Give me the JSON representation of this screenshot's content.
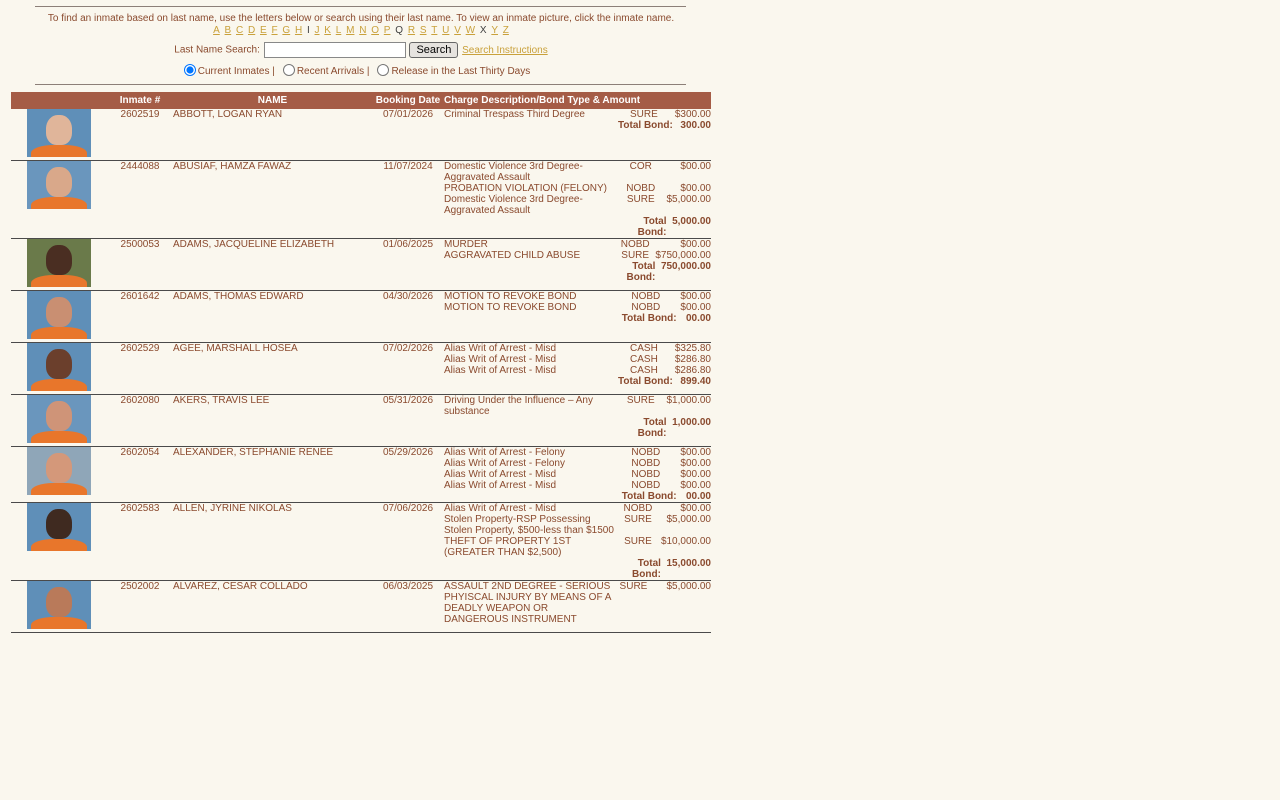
{
  "instructions": "To find an inmate based on last name, use the letters below or search using their last name.  To view an inmate picture, click the inmate name.",
  "letters": [
    {
      "l": "A",
      "on": true
    },
    {
      "l": "B",
      "on": true
    },
    {
      "l": "C",
      "on": true
    },
    {
      "l": "D",
      "on": true
    },
    {
      "l": "E",
      "on": true
    },
    {
      "l": "F",
      "on": true
    },
    {
      "l": "G",
      "on": true
    },
    {
      "l": "H",
      "on": true
    },
    {
      "l": "I",
      "on": false
    },
    {
      "l": "J",
      "on": true
    },
    {
      "l": "K",
      "on": true
    },
    {
      "l": "L",
      "on": true
    },
    {
      "l": "M",
      "on": true
    },
    {
      "l": "N",
      "on": true
    },
    {
      "l": "O",
      "on": true
    },
    {
      "l": "P",
      "on": true
    },
    {
      "l": "Q",
      "on": false
    },
    {
      "l": "R",
      "on": true
    },
    {
      "l": "S",
      "on": true
    },
    {
      "l": "T",
      "on": true
    },
    {
      "l": "U",
      "on": true
    },
    {
      "l": "V",
      "on": true
    },
    {
      "l": "W",
      "on": true
    },
    {
      "l": "X",
      "on": false
    },
    {
      "l": "Y",
      "on": true
    },
    {
      "l": "Z",
      "on": true
    }
  ],
  "search": {
    "label": "Last Name Search:",
    "value": "",
    "button": "Search",
    "help_link": "Search Instructions"
  },
  "filters": [
    {
      "label": "Current Inmates |",
      "checked": true
    },
    {
      "label": "Recent Arrivals |",
      "checked": false
    },
    {
      "label": "Release in the Last Thirty Days",
      "checked": false
    }
  ],
  "columns": {
    "photo": "",
    "number": "Inmate #",
    "name": "NAME",
    "date": "Booking Date",
    "charges": "Charge Description/Bond Type & Amount"
  },
  "total_label": "Total Bond:",
  "colors": {
    "header": "#a55c46",
    "text": "#8a4a2e",
    "link": "#c9a13b",
    "background": "#faf7ee"
  },
  "inmates": [
    {
      "number": "2602519",
      "name": "ABBOTT, LOGAN RYAN",
      "date": "07/01/2026",
      "total": "300.00",
      "mug": {
        "skin": "#e0b59a",
        "bg": "#5f8fb8"
      },
      "charges": [
        {
          "desc": "Criminal Trespass Third Degree",
          "type": "SURE",
          "amount": "$300.00"
        }
      ]
    },
    {
      "number": "2444088",
      "name": "ABUSIAF, HAMZA FAWAZ",
      "date": "11/07/2024",
      "total": "5,000.00",
      "mug": {
        "skin": "#d9a88a",
        "bg": "#6a96bd"
      },
      "charges": [
        {
          "desc": "Domestic Violence 3rd Degree- Aggravated Assault",
          "type": "COR",
          "amount": "$00.00"
        },
        {
          "desc": "PROBATION VIOLATION (FELONY)",
          "type": "NOBD",
          "amount": "$00.00"
        },
        {
          "desc": "Domestic Violence 3rd Degree- Aggravated Assault",
          "type": "SURE",
          "amount": "$5,000.00"
        }
      ]
    },
    {
      "number": "2500053",
      "name": "ADAMS, JACQUELINE ELIZABETH",
      "date": "01/06/2025",
      "total": "750,000.00",
      "mug": {
        "skin": "#4a2e22",
        "bg": "#6a7a4a"
      },
      "charges": [
        {
          "desc": "MURDER",
          "type": "NOBD",
          "amount": "$00.00"
        },
        {
          "desc": "AGGRAVATED CHILD ABUSE",
          "type": "SURE",
          "amount": "$750,000.00"
        }
      ]
    },
    {
      "number": "2601642",
      "name": "ADAMS, THOMAS EDWARD",
      "date": "04/30/2026",
      "total": "00.00",
      "mug": {
        "skin": "#c98f72",
        "bg": "#5f8fb8"
      },
      "charges": [
        {
          "desc": "MOTION TO REVOKE BOND",
          "type": "NOBD",
          "amount": "$00.00"
        },
        {
          "desc": "MOTION TO REVOKE BOND",
          "type": "NOBD",
          "amount": "$00.00"
        }
      ]
    },
    {
      "number": "2602529",
      "name": "AGEE, MARSHALL HOSEA",
      "date": "07/02/2026",
      "total": "899.40",
      "mug": {
        "skin": "#6b3f2c",
        "bg": "#5f8fb8"
      },
      "charges": [
        {
          "desc": "Alias Writ of Arrest - Misd",
          "type": "CASH",
          "amount": "$325.80"
        },
        {
          "desc": "Alias Writ of Arrest - Misd",
          "type": "CASH",
          "amount": "$286.80"
        },
        {
          "desc": "Alias Writ of Arrest - Misd",
          "type": "CASH",
          "amount": "$286.80"
        }
      ]
    },
    {
      "number": "2602080",
      "name": "AKERS, TRAVIS LEE",
      "date": "05/31/2026",
      "total": "1,000.00",
      "mug": {
        "skin": "#cf9478",
        "bg": "#6a96bd"
      },
      "charges": [
        {
          "desc": "Driving Under the Influence – Any substance",
          "type": "SURE",
          "amount": "$1,000.00"
        }
      ]
    },
    {
      "number": "2602054",
      "name": "ALEXANDER, STEPHANIE RENEE",
      "date": "05/29/2026",
      "total": "00.00",
      "mug": {
        "skin": "#d4987a",
        "bg": "#8fa6b8"
      },
      "charges": [
        {
          "desc": "Alias Writ of Arrest - Felony",
          "type": "NOBD",
          "amount": "$00.00"
        },
        {
          "desc": "Alias Writ of Arrest - Felony",
          "type": "NOBD",
          "amount": "$00.00"
        },
        {
          "desc": "Alias Writ of Arrest - Misd",
          "type": "NOBD",
          "amount": "$00.00"
        },
        {
          "desc": "Alias Writ of Arrest - Misd",
          "type": "NOBD",
          "amount": "$00.00"
        }
      ]
    },
    {
      "number": "2602583",
      "name": "ALLEN, JYRINE NIKOLAS",
      "date": "07/06/2026",
      "total": "15,000.00",
      "mug": {
        "skin": "#3f2a20",
        "bg": "#5f8fb8"
      },
      "charges": [
        {
          "desc": "Alias Writ of Arrest - Misd",
          "type": "NOBD",
          "amount": "$00.00"
        },
        {
          "desc": "Stolen Property-RSP Possessing Stolen Property, $500-less than $1500",
          "type": "SURE",
          "amount": "$5,000.00"
        },
        {
          "desc": "THEFT OF PROPERTY 1ST (GREATER THAN $2,500)",
          "type": "SURE",
          "amount": "$10,000.00"
        }
      ]
    },
    {
      "number": "2502002",
      "name": "ALVAREZ, CESAR COLLADO",
      "date": "06/03/2025",
      "total": "",
      "mug": {
        "skin": "#b97a5a",
        "bg": "#5f8fb8"
      },
      "charges": [
        {
          "desc": "ASSAULT 2ND DEGREE - SERIOUS PHYISCAL INJURY BY MEANS OF A DEADLY WEAPON OR DANGEROUS INSTRUMENT",
          "type": "SURE",
          "amount": "$5,000.00"
        }
      ]
    }
  ]
}
